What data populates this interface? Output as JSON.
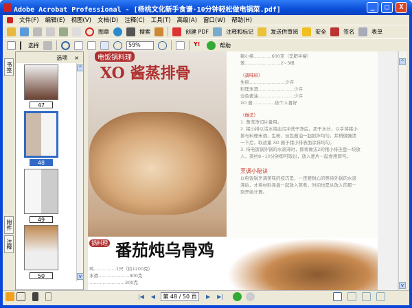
{
  "window": {
    "title": "Adobe Acrobat Professional - [杨桃文化新手食谱·10分钟轻松做电锅菜.pdf]",
    "minimize": "_",
    "maximize": "□",
    "close": "X"
  },
  "menu": [
    "文件(F)",
    "编辑(E)",
    "视图(V)",
    "文档(D)",
    "注释(C)",
    "工具(T)",
    "高级(A)",
    "窗口(W)",
    "帮助(H)"
  ],
  "toolbar1": {
    "stamp": "图章",
    "search": "搜索",
    "create_pdf": "创建 PDF",
    "comment": "注释和标记",
    "review": "发送供审阅",
    "secure": "安全",
    "sign": "签名",
    "forms": "表单"
  },
  "toolbar2": {
    "select": "选择",
    "zoom": "59%",
    "help": "帮助"
  },
  "sidebar": {
    "tabs": [
      "书签",
      "签名",
      "附件",
      "注释"
    ],
    "options": "选项",
    "close": "×",
    "pages": [
      {
        "num": "47"
      },
      {
        "num": "48",
        "selected": true
      },
      {
        "num": "49"
      },
      {
        "num": "50"
      }
    ]
  },
  "document": {
    "left_tag": "电饭锅料理",
    "left_title": "XO 酱蒸排骨",
    "bottom_tag": "锅料理",
    "bottom_title": "番茄炖乌骨鸡",
    "bottom_lines": [
      "鸡……………1只（约1200克）",
      "水酒…………………900克",
      "……………………300克"
    ],
    "right_top": [
      "猪小排…………600克（辛肥半瘦）",
      "葱……………………2~3根"
    ],
    "seasoning_header": "（调味料）",
    "seasoning": [
      "生粉……………………少许",
      "料理米酒……………………少许",
      "淡色酱油……………………少许",
      "XO 酱……………依个人喜好"
    ],
    "method_header": "（做法）",
    "method": [
      "1. 葱洗净切片备用。",
      "2. 猪小排以活水将血污冲洗干净后，沥干水分，以手将猪小排与料理米酒、生粉、淡色酱油一起抓拌均匀，并稍微腌渍一下后，取适量 XO 酱于猪小排表面涂抹均匀。",
      "3. 待电饭锅外锅的水滚沸时，即将做法2的猪小排连盘一块放入，蒸约8~10分钟即可取出，放入葱片一起食用即可。"
    ],
    "tip_header": "烹调小秘诀",
    "tip": "以电饭锅烹调美味的技巧是，一定要耐心的等待外锅的水滚沸后，才将材料连盘一起放入蒸煮，时间也是从放入的那一刻开始计算。"
  },
  "status": {
    "page": "第 48 / 50 页"
  }
}
